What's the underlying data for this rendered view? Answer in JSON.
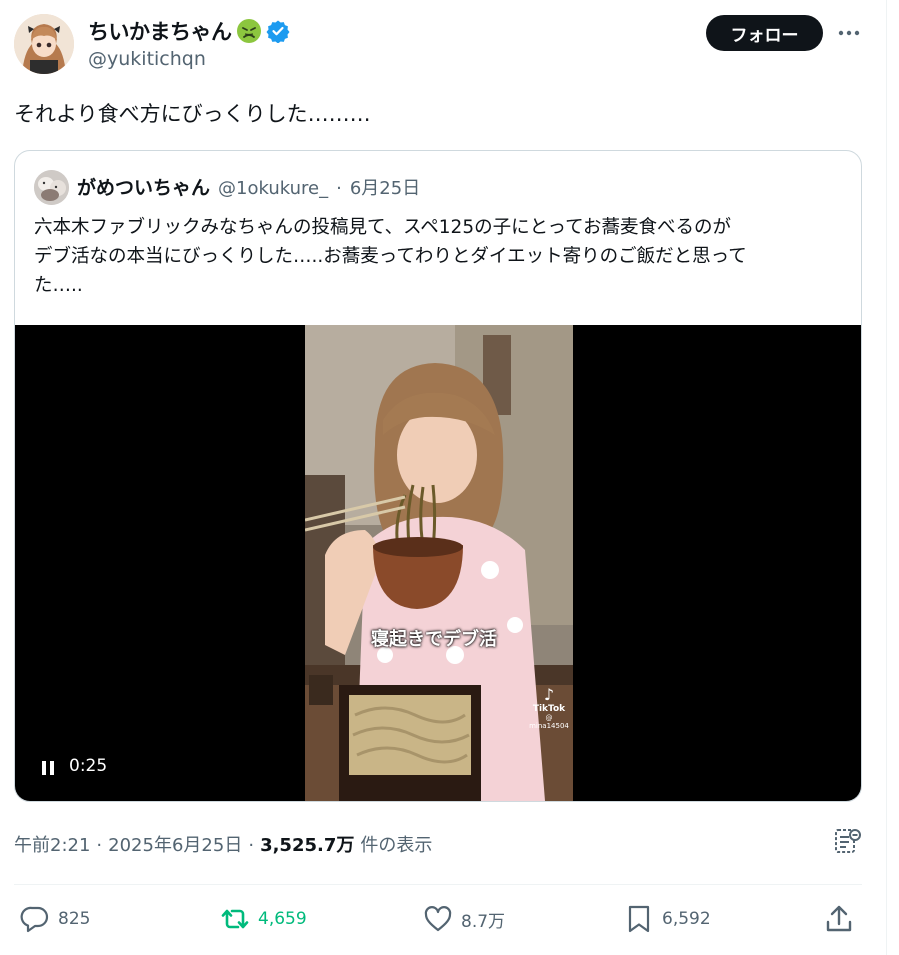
{
  "author": {
    "display_name": "ちいかまちゃん",
    "handle": "@yukitichqn",
    "emoji_icon": "sick-face-emoji",
    "verified_icon": "verified-badge-icon",
    "verified_color": "#1d9bf0"
  },
  "follow_label": "フォロー",
  "tweet_text": "それより食べ方にびっくりした………",
  "quote": {
    "display_name": "がめついちゃん",
    "handle": "@1okukure_",
    "separator": "·",
    "date": "6月25日",
    "text_lines": [
      "六本木ファブリックみなちゃんの投稿見て、スペ125の子にとってお蕎麦食べるのが",
      "デブ活なの本当にびっくりした…..お蕎麦ってわりとダイエット寄りのご飯だと思って",
      "た….."
    ],
    "video": {
      "caption": "寝起きでデブ活",
      "watermark": "TikTok",
      "watermark_user": "@ mina14504",
      "time": "0:25",
      "state_icon": "pause-icon"
    }
  },
  "meta": {
    "time": "午前2:21",
    "sep1": "·",
    "date": "2025年6月25日",
    "sep2": "·",
    "views": "3,525.7万",
    "views_label": "件の表示"
  },
  "actions": {
    "replies": "825",
    "retweets": "4,659",
    "likes": "8.7万",
    "bookmarks": "6,592"
  },
  "colors": {
    "text_primary": "#0f1419",
    "text_secondary": "#536471",
    "retweet_green": "#00ba7c",
    "border": "#cfd9de"
  }
}
